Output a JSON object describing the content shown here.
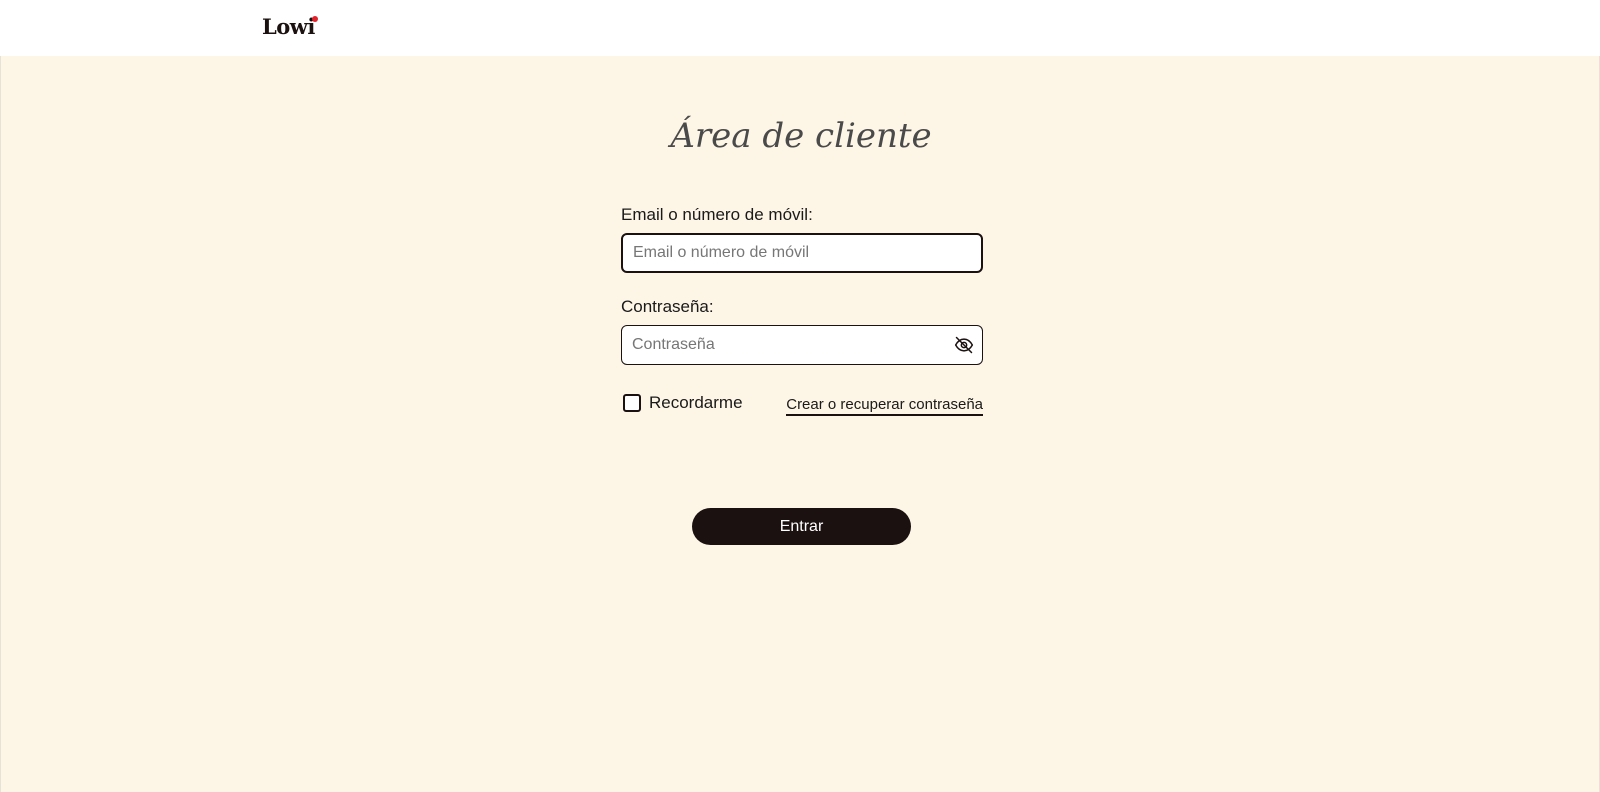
{
  "header": {
    "logo_text": "Lowi",
    "brand_accent": "#e1222a"
  },
  "page": {
    "title": "Área de cliente",
    "background": "#fdf5e6"
  },
  "form": {
    "email": {
      "label": "Email o número de móvil:",
      "placeholder": "Email o número de móvil",
      "value": ""
    },
    "password": {
      "label": "Contraseña:",
      "placeholder": "Contraseña",
      "value": "",
      "toggle_icon": "eye-off-icon"
    },
    "remember_label": "Recordarme",
    "remember_checked": false,
    "forgot_link": "Crear o recuperar contraseña",
    "submit_label": "Entrar",
    "button_color": "#1b1110"
  }
}
